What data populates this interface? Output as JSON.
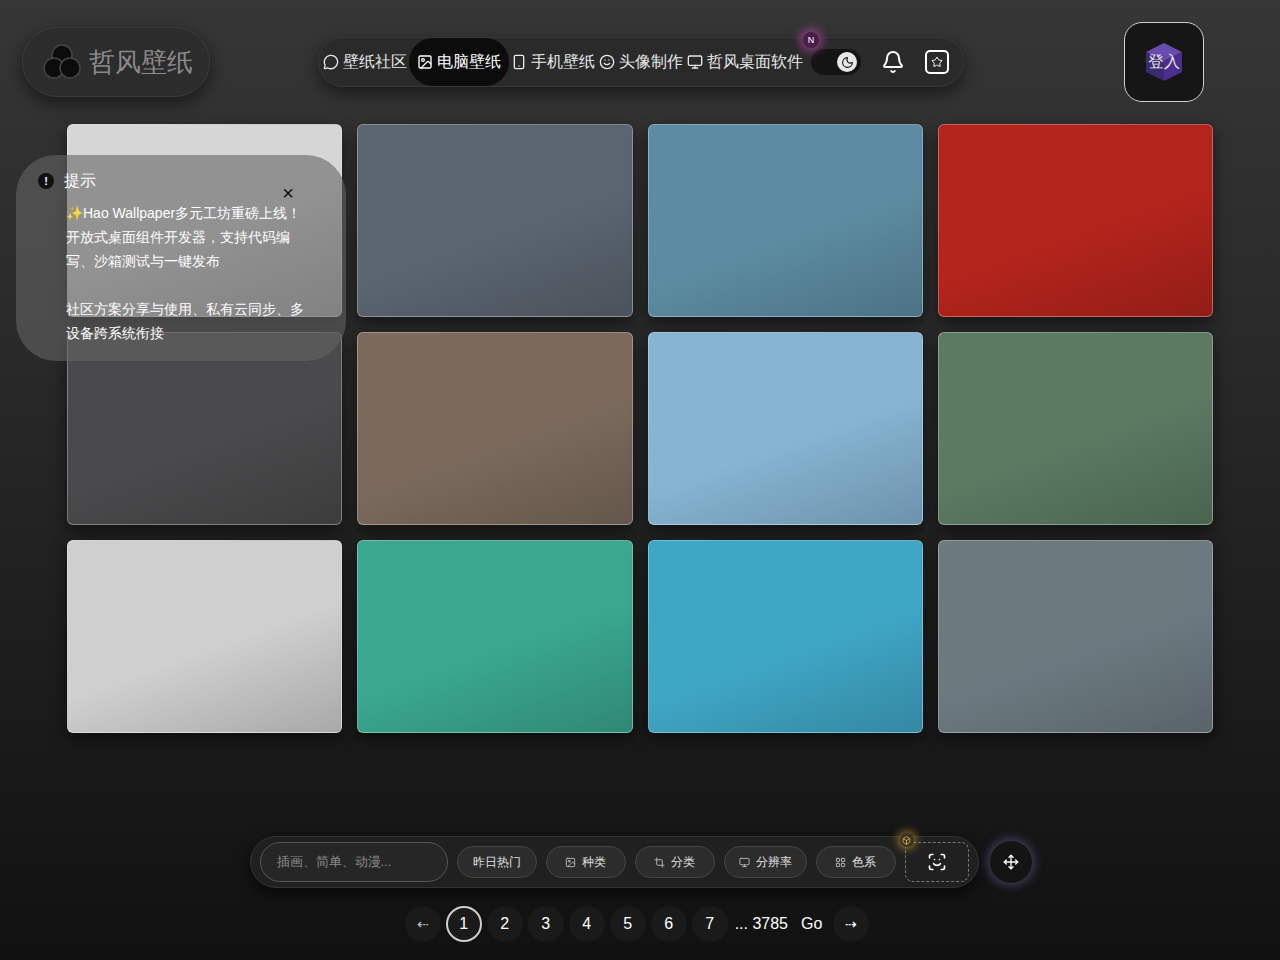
{
  "logo": {
    "text": "哲风壁纸"
  },
  "nav": [
    {
      "label": "壁纸社区",
      "icon": "community",
      "selected": false
    },
    {
      "label": "电脑壁纸",
      "icon": "desktop",
      "selected": true
    },
    {
      "label": "手机壁纸",
      "icon": "phone",
      "selected": false
    },
    {
      "label": "头像制作",
      "icon": "avatar",
      "selected": false
    },
    {
      "label": "哲风桌面软件",
      "icon": "software",
      "selected": false
    }
  ],
  "notice_badge": "N",
  "theme_toggle": {
    "on": true
  },
  "login": {
    "label": "登入"
  },
  "toast": {
    "icon": "!",
    "title": "提示",
    "close": "×",
    "paragraphs": [
      "✨Hao Wallpaper多元工坊重磅上线！开放式桌面组件开发器，支持代码编写、沙箱测试与一键发布",
      "社区方案分享与使用、私有云同步、多设备跨系统衔接"
    ]
  },
  "wallpapers": [
    {
      "color": "#d6d6d6"
    },
    {
      "color": "#5b6570"
    },
    {
      "color": "#5d8ca2"
    },
    {
      "color": "#b3241c"
    },
    {
      "color": "#4a4a4c"
    },
    {
      "color": "#7b6a5c"
    },
    {
      "color": "#86b4d2"
    },
    {
      "color": "#5a7a62"
    },
    {
      "color": "#cfcfcf"
    },
    {
      "color": "#3aa78f"
    },
    {
      "color": "#3fa7c6"
    },
    {
      "color": "#6c7a80"
    }
  ],
  "toolbar": {
    "search_placeholder": "插画、简单、动漫...",
    "filters": [
      {
        "label": "昨日热门",
        "kind": "plain"
      },
      {
        "label": "种类",
        "kind": "type"
      },
      {
        "label": "分类",
        "kind": "category"
      },
      {
        "label": "分辨率",
        "kind": "resolution"
      },
      {
        "label": "色系",
        "kind": "color"
      }
    ]
  },
  "pagination": {
    "prev": "⇠",
    "pages": [
      {
        "label": "1",
        "selected": true
      },
      {
        "label": "2",
        "selected": false
      },
      {
        "label": "3",
        "selected": false
      },
      {
        "label": "4",
        "selected": false
      },
      {
        "label": "5",
        "selected": false
      },
      {
        "label": "6",
        "selected": false
      },
      {
        "label": "7",
        "selected": false
      }
    ],
    "last": "... 3785",
    "go": "Go",
    "next": "⇢"
  }
}
